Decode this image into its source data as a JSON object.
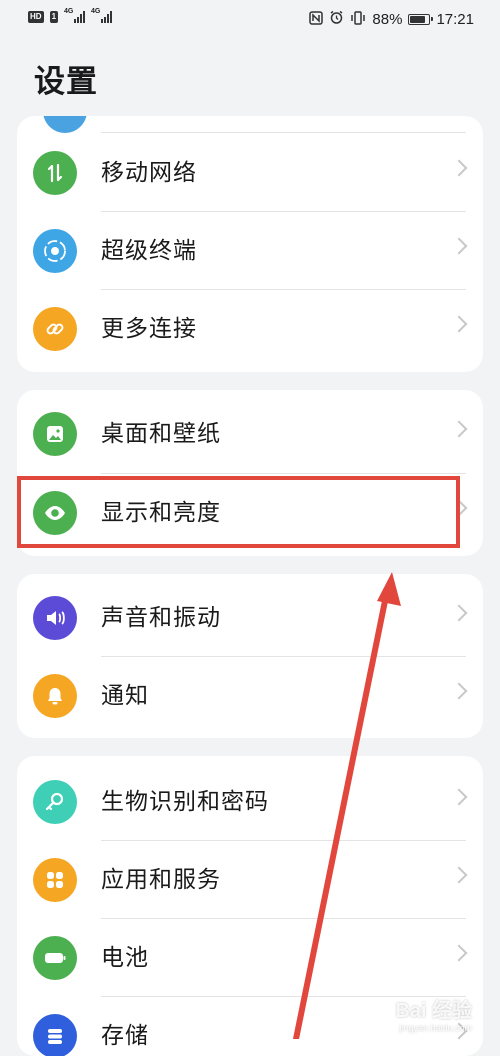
{
  "status_bar": {
    "left_badge": "HD",
    "left_sim": "1",
    "network_1": "4G",
    "network_2": "4G",
    "battery_percent": "88%",
    "battery_level": 0.88,
    "time": "17:21",
    "icons": [
      "nfc-icon",
      "alarm-icon",
      "vibrate-icon"
    ]
  },
  "page": {
    "title": "设置"
  },
  "groups": [
    {
      "items": [
        {
          "label": "移动网络",
          "icon": "mobile-data-icon",
          "color": "#4caf50"
        },
        {
          "label": "超级终端",
          "icon": "super-device-icon",
          "color": "#3fa6e6"
        },
        {
          "label": "更多连接",
          "icon": "link-icon",
          "color": "#f5a623"
        }
      ]
    },
    {
      "items": [
        {
          "label": "桌面和壁纸",
          "icon": "wallpaper-icon",
          "color": "#4caf50"
        },
        {
          "label": "显示和亮度",
          "icon": "eye-icon",
          "color": "#4caf50"
        }
      ]
    },
    {
      "items": [
        {
          "label": "声音和振动",
          "icon": "sound-icon",
          "color": "#5b4bd7"
        },
        {
          "label": "通知",
          "icon": "bell-icon",
          "color": "#f5a623"
        }
      ]
    },
    {
      "items": [
        {
          "label": "生物识别和密码",
          "icon": "key-icon",
          "color": "#3ecfb6"
        },
        {
          "label": "应用和服务",
          "icon": "apps-icon",
          "color": "#f5a623"
        },
        {
          "label": "电池",
          "icon": "battery-icon",
          "color": "#4caf50"
        },
        {
          "label": "存储",
          "icon": "storage-icon",
          "color": "#2f5fdc"
        }
      ]
    }
  ],
  "annotation": {
    "highlight_color": "#e1473c"
  },
  "watermark": {
    "text": "Bai 经验",
    "sub": "jingyan.baidu.com"
  }
}
